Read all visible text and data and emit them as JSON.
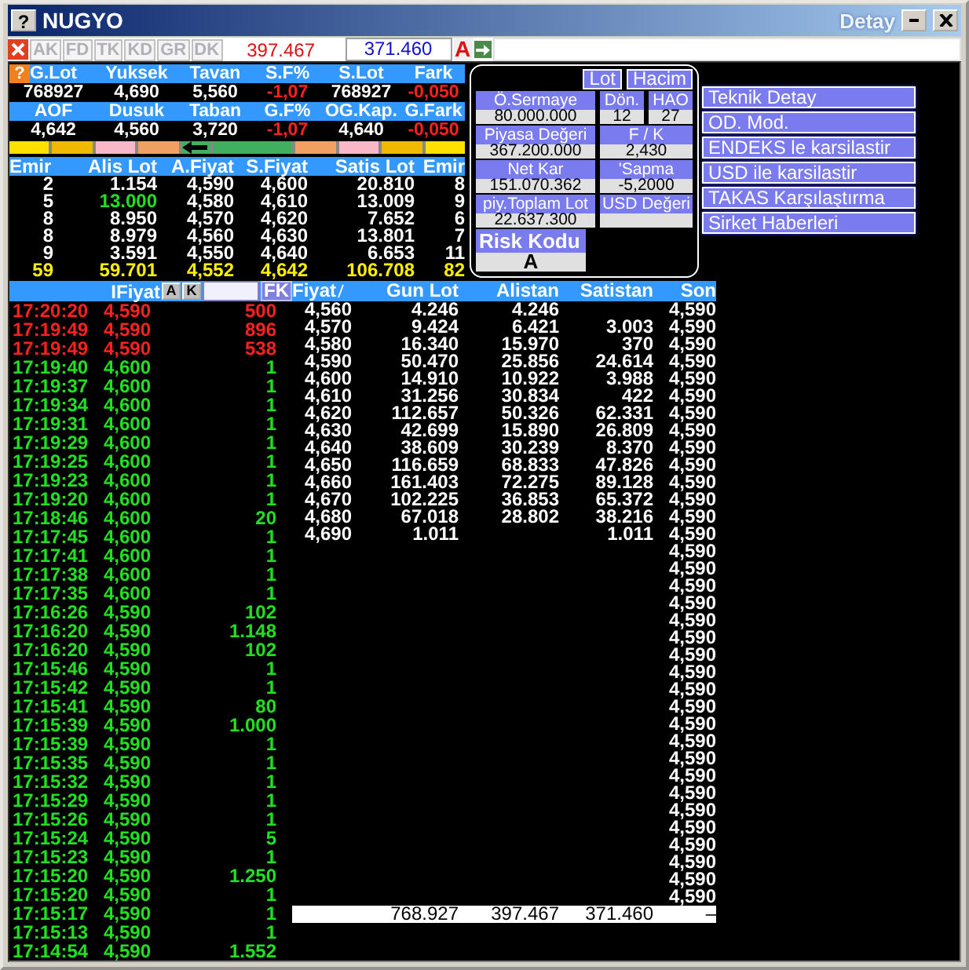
{
  "window": {
    "help_label": "?",
    "title": "NUGYO",
    "detail_label": "Detay"
  },
  "stats_help": "?",
  "toolbar": {
    "tabs": [
      {
        "label": "AK",
        "disabled": true
      },
      {
        "label": "FD",
        "disabled": true
      },
      {
        "label": "TK",
        "disabled": true
      },
      {
        "label": "KD",
        "disabled": true
      },
      {
        "label": "GR",
        "disabled": true
      },
      {
        "label": "DK",
        "disabled": true
      }
    ],
    "sell_total": "397.467",
    "buy_total": "371.460",
    "flag": "A"
  },
  "stats": [
    {
      "headers": [
        "G.Lot",
        "Yuksek",
        "Tavan",
        "S.F%",
        "S.Lot",
        "Fark"
      ],
      "values": [
        {
          "text": "768927",
          "negative": false
        },
        {
          "text": "4,690",
          "negative": false
        },
        {
          "text": "5,560",
          "negative": false
        },
        {
          "text": "-1,07",
          "negative": true
        },
        {
          "text": "768927",
          "negative": false
        },
        {
          "text": "-0,050",
          "negative": true
        }
      ]
    },
    {
      "headers": [
        "AOF",
        "Dusuk",
        "Taban",
        "G.F%",
        "OG.Kap.",
        "G.Fark"
      ],
      "values": [
        {
          "text": "4,642",
          "negative": false
        },
        {
          "text": "4,560",
          "negative": false
        },
        {
          "text": "3,720",
          "negative": false
        },
        {
          "text": "-1,07",
          "negative": true
        },
        {
          "text": "4,640",
          "negative": false
        },
        {
          "text": "-0,050",
          "negative": true
        }
      ]
    }
  ],
  "depth_bar": {
    "left": [
      {
        "color": "#ffe000"
      },
      {
        "color": "#f0b800"
      },
      {
        "color": "#f8b8c8"
      },
      {
        "color": "#f0a060"
      }
    ],
    "right": [
      {
        "color": "#40b060"
      },
      {
        "color": "#f0a060"
      },
      {
        "color": "#f8b8c8"
      },
      {
        "color": "#f0b800"
      },
      {
        "color": "#ffe000"
      }
    ]
  },
  "order_book": {
    "columns": [
      "Emir",
      "Alis Lot",
      "A.Fiyat",
      "S.Fiyat",
      "Satis Lot",
      "Emir"
    ],
    "rows": [
      {
        "cells": [
          "2",
          "1.154",
          "4,590",
          "4,600",
          "20.810",
          "8"
        ],
        "alis_lot_highlighted": false
      },
      {
        "cells": [
          "5",
          "13.000",
          "4,580",
          "4,610",
          "13.009",
          "9"
        ],
        "alis_lot_highlighted": true
      },
      {
        "cells": [
          "8",
          "8.950",
          "4,570",
          "4,620",
          "7.652",
          "6"
        ],
        "alis_lot_highlighted": false
      },
      {
        "cells": [
          "8",
          "8.979",
          "4,560",
          "4,630",
          "13.801",
          "7"
        ],
        "alis_lot_highlighted": false
      },
      {
        "cells": [
          "9",
          "3.591",
          "4,550",
          "4,640",
          "6.653",
          "11"
        ],
        "alis_lot_highlighted": false
      }
    ],
    "totals": [
      "59",
      "59.701",
      "4,552",
      "4,642",
      "106.708",
      "82"
    ]
  },
  "panel": {
    "buttons": [
      "Lot",
      "Hacim"
    ],
    "field_rows": [
      [
        {
          "label": "Ö.Sermaye",
          "value": "80.000.000"
        },
        {
          "label": "Dön.",
          "value": "12"
        },
        {
          "label": "HAO",
          "value": "27"
        }
      ],
      [
        {
          "label": "Piyasa Değeri",
          "value": "367.200.000"
        },
        {
          "label": "F / K",
          "value": "2,430"
        }
      ],
      [
        {
          "label": "Net Kar",
          "value": "151.070.362"
        },
        {
          "label": "'Sapma",
          "value": "-5,2000"
        }
      ],
      [
        {
          "label": "piy.Toplam Lot",
          "value": "22.637.300"
        },
        {
          "label": "USD Değeri"
        }
      ]
    ],
    "risk": {
      "label": "Risk Kodu",
      "value": "A"
    }
  },
  "links": [
    "Teknik Detay",
    "OD. Mod.",
    "ENDEKS le karsilastir",
    "USD ile karsilastir",
    "TAKAS Karşılaştırma",
    "Sirket Haberleri"
  ],
  "trades": {
    "price_label": "IFiyat",
    "buttons": [
      "A",
      "K"
    ],
    "filter_button": "FK",
    "rows": [
      {
        "time": "17:20:20",
        "price": "4,590",
        "lot": "500",
        "color": "#ff2020"
      },
      {
        "time": "17:19:49",
        "price": "4,590",
        "lot": "896",
        "color": "#ff2020"
      },
      {
        "time": "17:19:49",
        "price": "4,590",
        "lot": "538",
        "color": "#ff2020"
      },
      {
        "time": "17:19:40",
        "price": "4,600",
        "lot": "1",
        "color": "#20e020"
      },
      {
        "time": "17:19:37",
        "price": "4,600",
        "lot": "1",
        "color": "#20e020"
      },
      {
        "time": "17:19:34",
        "price": "4,600",
        "lot": "1",
        "color": "#20e020"
      },
      {
        "time": "17:19:31",
        "price": "4,600",
        "lot": "1",
        "color": "#20e020"
      },
      {
        "time": "17:19:29",
        "price": "4,600",
        "lot": "1",
        "color": "#20e020"
      },
      {
        "time": "17:19:25",
        "price": "4,600",
        "lot": "1",
        "color": "#20e020"
      },
      {
        "time": "17:19:23",
        "price": "4,600",
        "lot": "1",
        "color": "#20e020"
      },
      {
        "time": "17:19:20",
        "price": "4,600",
        "lot": "1",
        "color": "#20e020"
      },
      {
        "time": "17:18:46",
        "price": "4,600",
        "lot": "20",
        "color": "#20e020"
      },
      {
        "time": "17:17:45",
        "price": "4,600",
        "lot": "1",
        "color": "#20e020"
      },
      {
        "time": "17:17:41",
        "price": "4,600",
        "lot": "1",
        "color": "#20e020"
      },
      {
        "time": "17:17:38",
        "price": "4,600",
        "lot": "1",
        "color": "#20e020"
      },
      {
        "time": "17:17:35",
        "price": "4,600",
        "lot": "1",
        "color": "#20e020"
      },
      {
        "time": "17:16:26",
        "price": "4,590",
        "lot": "102",
        "color": "#20e020"
      },
      {
        "time": "17:16:20",
        "price": "4,590",
        "lot": "1.148",
        "color": "#20e020"
      },
      {
        "time": "17:16:20",
        "price": "4,590",
        "lot": "102",
        "color": "#20e020"
      },
      {
        "time": "17:15:46",
        "price": "4,590",
        "lot": "1",
        "color": "#20e020"
      },
      {
        "time": "17:15:42",
        "price": "4,590",
        "lot": "1",
        "color": "#20e020"
      },
      {
        "time": "17:15:41",
        "price": "4,590",
        "lot": "80",
        "color": "#20e020"
      },
      {
        "time": "17:15:39",
        "price": "4,590",
        "lot": "1.000",
        "color": "#20e020"
      },
      {
        "time": "17:15:39",
        "price": "4,590",
        "lot": "1",
        "color": "#20e020"
      },
      {
        "time": "17:15:35",
        "price": "4,590",
        "lot": "1",
        "color": "#20e020"
      },
      {
        "time": "17:15:32",
        "price": "4,590",
        "lot": "1",
        "color": "#20e020"
      },
      {
        "time": "17:15:29",
        "price": "4,590",
        "lot": "1",
        "color": "#20e020"
      },
      {
        "time": "17:15:26",
        "price": "4,590",
        "lot": "1",
        "color": "#20e020"
      },
      {
        "time": "17:15:24",
        "price": "4,590",
        "lot": "5",
        "color": "#20e020"
      },
      {
        "time": "17:15:23",
        "price": "4,590",
        "lot": "1",
        "color": "#20e020"
      },
      {
        "time": "17:15:20",
        "price": "4,590",
        "lot": "1.250",
        "color": "#20e020"
      },
      {
        "time": "17:15:20",
        "price": "4,590",
        "lot": "1",
        "color": "#20e020"
      },
      {
        "time": "17:15:17",
        "price": "4,590",
        "lot": "1",
        "color": "#20e020"
      },
      {
        "time": "17:15:13",
        "price": "4,590",
        "lot": "1",
        "color": "#20e020"
      },
      {
        "time": "17:14:54",
        "price": "4,590",
        "lot": "1.552",
        "color": "#20e020"
      }
    ]
  },
  "price_table": {
    "columns": [
      "Fiyat",
      "Gun Lot",
      "Alistan",
      "Satistan",
      "Son"
    ],
    "rows": [
      {
        "fiyat": "4,560",
        "gun_lot": "4.246",
        "alistan": "4.246",
        "son": "4,590"
      },
      {
        "fiyat": "4,570",
        "gun_lot": "9.424",
        "alistan": "6.421",
        "satistan": "3.003",
        "son": "4,590"
      },
      {
        "fiyat": "4,580",
        "gun_lot": "16.340",
        "alistan": "15.970",
        "satistan": "370",
        "son": "4,590"
      },
      {
        "fiyat": "4,590",
        "gun_lot": "50.470",
        "alistan": "25.856",
        "satistan": "24.614",
        "son": "4,590"
      },
      {
        "fiyat": "4,600",
        "gun_lot": "14.910",
        "alistan": "10.922",
        "satistan": "3.988",
        "son": "4,590"
      },
      {
        "fiyat": "4,610",
        "gun_lot": "31.256",
        "alistan": "30.834",
        "satistan": "422",
        "son": "4,590"
      },
      {
        "fiyat": "4,620",
        "gun_lot": "112.657",
        "alistan": "50.326",
        "satistan": "62.331",
        "son": "4,590"
      },
      {
        "fiyat": "4,630",
        "gun_lot": "42.699",
        "alistan": "15.890",
        "satistan": "26.809",
        "son": "4,590"
      },
      {
        "fiyat": "4,640",
        "gun_lot": "38.609",
        "alistan": "30.239",
        "satistan": "8.370",
        "son": "4,590"
      },
      {
        "fiyat": "4,650",
        "gun_lot": "116.659",
        "alistan": "68.833",
        "satistan": "47.826",
        "son": "4,590"
      },
      {
        "fiyat": "4,660",
        "gun_lot": "161.403",
        "alistan": "72.275",
        "satistan": "89.128",
        "son": "4,590"
      },
      {
        "fiyat": "4,670",
        "gun_lot": "102.225",
        "alistan": "36.853",
        "satistan": "65.372",
        "son": "4,590"
      },
      {
        "fiyat": "4,680",
        "gun_lot": "67.018",
        "alistan": "28.802",
        "satistan": "38.216",
        "son": "4,590"
      },
      {
        "fiyat": "4,690",
        "gun_lot": "1.011",
        "satistan": "1.011",
        "son": "4,590"
      },
      {
        "son": "4,590"
      },
      {
        "son": "4,590"
      },
      {
        "son": "4,590"
      },
      {
        "son": "4,590"
      },
      {
        "son": "4,590"
      },
      {
        "son": "4,590"
      },
      {
        "son": "4,590"
      },
      {
        "son": "4,590"
      },
      {
        "son": "4,590"
      },
      {
        "son": "4,590"
      },
      {
        "son": "4,590"
      },
      {
        "son": "4,590"
      },
      {
        "son": "4,590"
      },
      {
        "son": "4,590"
      },
      {
        "son": "4,590"
      },
      {
        "son": "4,590"
      },
      {
        "son": "4,590"
      },
      {
        "son": "4,590"
      },
      {
        "son": "4,590"
      },
      {
        "son": "4,590"
      },
      {
        "son": "4,590"
      }
    ],
    "totals": {
      "gun_lot": "768.927",
      "alistan": "397.467",
      "satistan": "371.460",
      "son": "–"
    }
  }
}
